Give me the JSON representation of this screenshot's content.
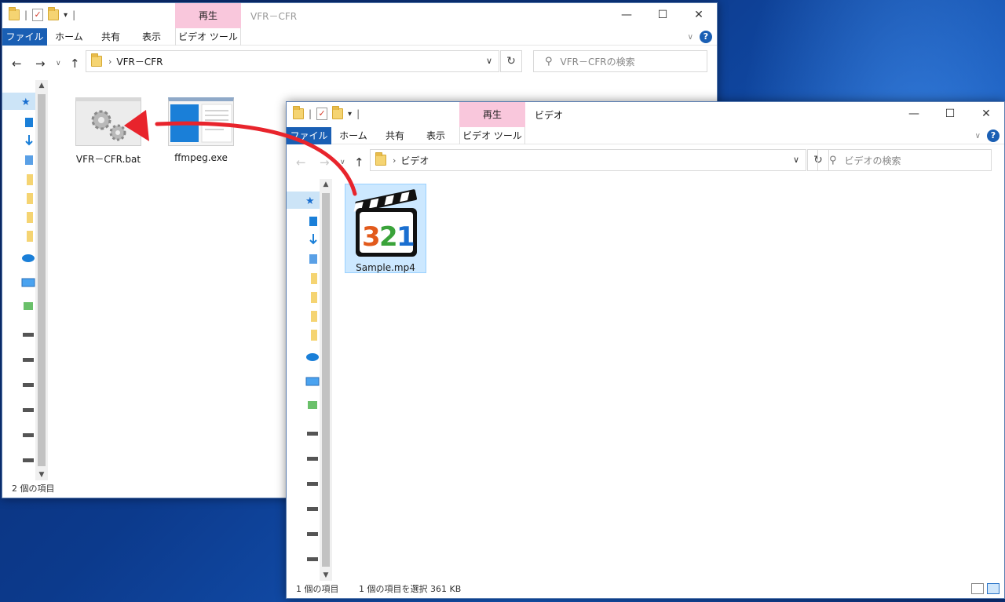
{
  "window1": {
    "qat_arrow": "▾",
    "qat_sep": "|",
    "context_tab": "再生",
    "title": "VFR－CFR",
    "tabs": {
      "file": "ファイル",
      "home": "ホーム",
      "share": "共有",
      "view": "表示",
      "tools": "ビデオ ツール"
    },
    "address": "VFR－CFR",
    "search_placeholder": "VFR－CFRの検索",
    "items": [
      {
        "name": "VFR－CFR.bat",
        "icon": "batch-file-gears-icon"
      },
      {
        "name": "ffmpeg.exe",
        "icon": "exe-window-icon"
      }
    ],
    "status": "2 個の項目"
  },
  "window2": {
    "qat_arrow": "▾",
    "qat_sep": "|",
    "context_tab": "再生",
    "title": "ビデオ",
    "tabs": {
      "file": "ファイル",
      "home": "ホーム",
      "share": "共有",
      "view": "表示",
      "tools": "ビデオ ツール"
    },
    "address": "ビデオ",
    "search_placeholder": "ビデオの検索",
    "items": [
      {
        "name": "Sample.mp4",
        "icon": "media-player-clapper-321-icon"
      }
    ],
    "status_count": "1 個の項目",
    "status_selected": "1 個の項目を選択  361 KB"
  },
  "glyphs": {
    "check": "✓",
    "minimize": "—",
    "maximize": "☐",
    "close": "✕",
    "chevron": "∨",
    "help": "?",
    "back": "←",
    "forward": "→",
    "recent": "∨",
    "up": "↑",
    "crumb": "›",
    "dropdown": "∨",
    "refresh": "↻",
    "search": "⚲",
    "scroll_up": "▲",
    "scroll_down": "▼"
  },
  "colors": {
    "file_tab": "#1a5fb4",
    "context_tab": "#f9c7dc",
    "drag_arrow": "#e8242c",
    "selection": "#cce8ff"
  }
}
